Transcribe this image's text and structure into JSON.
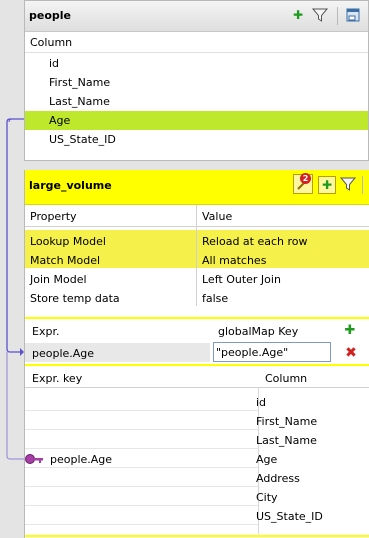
{
  "people": {
    "title": "people",
    "column_header": "Column",
    "columns": [
      "id",
      "First_Name",
      "Last_Name",
      "Age",
      "US_State_ID"
    ],
    "selected": "Age"
  },
  "lookup": {
    "title": "large_volume",
    "properties_header": {
      "property": "Property",
      "value": "Value"
    },
    "properties": [
      {
        "property": "Lookup Model",
        "value": "Reload at each row",
        "highlighted": true
      },
      {
        "property": "Match Model",
        "value": "All matches",
        "highlighted": true
      },
      {
        "property": "Join Model",
        "value": "Left Outer Join",
        "highlighted": false
      },
      {
        "property": "Store temp data",
        "value": "false",
        "highlighted": false
      }
    ],
    "expr_header": {
      "expr": "Expr.",
      "key": "globalMap Key"
    },
    "expr_row": {
      "expr": "people.Age",
      "key": "\"people.Age\""
    },
    "key_header": {
      "expr_key": "Expr. key",
      "column": "Column"
    },
    "key_expr": "people.Age",
    "columns": [
      "id",
      "First_Name",
      "Last_Name",
      "Age",
      "Address",
      "City",
      "US_State_ID"
    ],
    "warning_count": "2"
  },
  "colors": {
    "selected_row": "#bde82c",
    "lookup_title": "#ffff00",
    "highlight_row": "#f6f04a",
    "link_line": "#5a4fcf"
  }
}
